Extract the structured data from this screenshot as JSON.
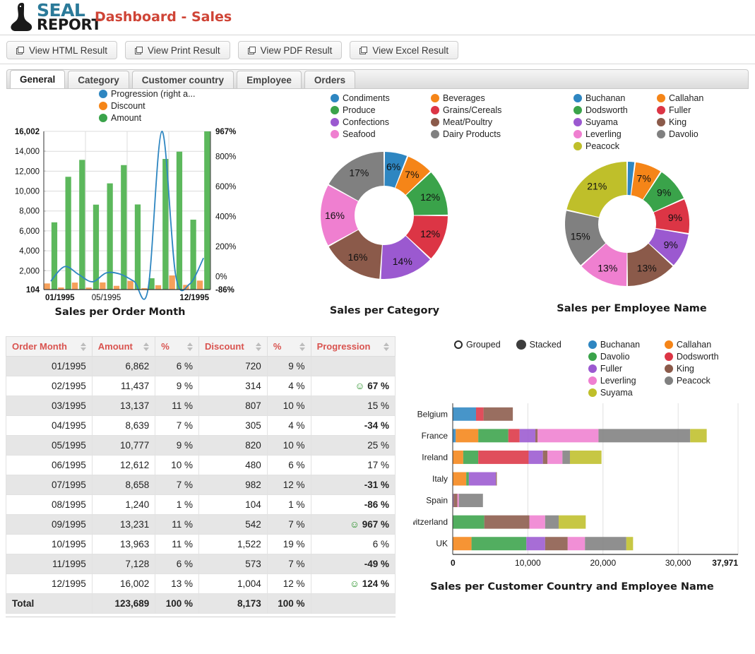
{
  "app": {
    "logo_top": "SEAL",
    "logo_bottom": "REPORT",
    "title": "Dashboard - Sales",
    "logo_color": "#2b7a99",
    "title_color": "#cf4436"
  },
  "toolbar": {
    "buttons": [
      {
        "label": "View HTML Result",
        "icon": "external-window-icon"
      },
      {
        "label": "View Print Result",
        "icon": "external-window-icon"
      },
      {
        "label": "View PDF Result",
        "icon": "external-window-icon"
      },
      {
        "label": "View Excel Result",
        "icon": "external-window-icon"
      }
    ]
  },
  "tabs": [
    {
      "label": "General",
      "active": true
    },
    {
      "label": "Category",
      "active": false
    },
    {
      "label": "Customer country",
      "active": false
    },
    {
      "label": "Employee",
      "active": false
    },
    {
      "label": "Orders",
      "active": false
    }
  ],
  "palette": {
    "blue": "#2e86c1",
    "orange": "#f58518",
    "green": "#3aa34a",
    "red": "#dc3545",
    "purple": "#9b59d0",
    "brown": "#8b5a4a",
    "pink": "#ef7fd0",
    "gray": "#808080",
    "olive": "#bfbf2a"
  },
  "chart_data": [
    {
      "id": "sales-per-order-month",
      "type": "bar",
      "title": "Sales per Order Month",
      "categories": [
        "01/1995",
        "02/1995",
        "03/1995",
        "04/1995",
        "05/1995",
        "06/1995",
        "07/1995",
        "08/1995",
        "09/1995",
        "10/1995",
        "11/1995",
        "12/1995"
      ],
      "xlabel": "",
      "ylabel": "",
      "x_tick_labels": [
        "01/1995",
        "05/1995",
        "12/1995"
      ],
      "left_axis": {
        "ticks": [
          "104",
          "2,000",
          "4,000",
          "6,000",
          "8,000",
          "10,000",
          "12,000",
          "14,000",
          "16,002"
        ],
        "min": 104,
        "max": 16002
      },
      "right_axis": {
        "ticks": [
          "-86%",
          "0%",
          "200%",
          "400%",
          "600%",
          "800%",
          "967%"
        ],
        "min": -86,
        "max": 967
      },
      "legend": [
        {
          "label": "Progression (right a...",
          "color": "#2e86c1"
        },
        {
          "label": "Discount",
          "color": "#f58518"
        },
        {
          "label": "Amount",
          "color": "#3aa34a"
        }
      ],
      "series": [
        {
          "name": "Amount",
          "kind": "bar",
          "color": "#3aa34a",
          "values": [
            6862,
            11437,
            13137,
            8639,
            10777,
            12612,
            8658,
            1240,
            13231,
            13963,
            7128,
            16002
          ]
        },
        {
          "name": "Discount",
          "kind": "bar",
          "color": "#f58518",
          "values": [
            720,
            314,
            807,
            305,
            820,
            480,
            982,
            104,
            542,
            1522,
            573,
            1004
          ]
        },
        {
          "name": "Progression (right a...)",
          "kind": "line",
          "color": "#2e86c1",
          "values": [
            null,
            67,
            15,
            -34,
            25,
            17,
            -31,
            -86,
            967,
            6,
            -49,
            124
          ]
        }
      ]
    },
    {
      "id": "sales-per-category",
      "type": "pie",
      "title": "Sales per Category",
      "hole": 0.38,
      "legend": [
        {
          "label": "Condiments",
          "color": "#2e86c1"
        },
        {
          "label": "Beverages",
          "color": "#f58518"
        },
        {
          "label": "Produce",
          "color": "#3aa34a"
        },
        {
          "label": "Grains/Cereals",
          "color": "#dc3545"
        },
        {
          "label": "Confections",
          "color": "#9b59d0"
        },
        {
          "label": "Meat/Poultry",
          "color": "#8b5a4a"
        },
        {
          "label": "Seafood",
          "color": "#ef7fd0"
        },
        {
          "label": "Dairy Products",
          "color": "#808080"
        }
      ],
      "slices": [
        {
          "label": "Condiments",
          "value": 6,
          "display": "6%",
          "color": "#2e86c1"
        },
        {
          "label": "Beverages",
          "value": 7,
          "display": "7%",
          "color": "#f58518"
        },
        {
          "label": "Produce",
          "value": 12,
          "display": "12%",
          "color": "#3aa34a"
        },
        {
          "label": "Grains/Cereals",
          "value": 12,
          "display": "12%",
          "color": "#dc3545"
        },
        {
          "label": "Confections",
          "value": 14,
          "display": "14%",
          "color": "#9b59d0"
        },
        {
          "label": "Meat/Poultry",
          "value": 16,
          "display": "16%",
          "color": "#8b5a4a"
        },
        {
          "label": "Seafood",
          "value": 16,
          "display": "16%",
          "color": "#ef7fd0"
        },
        {
          "label": "Dairy Products",
          "value": 17,
          "display": "17%",
          "color": "#808080"
        }
      ]
    },
    {
      "id": "sales-per-employee-name",
      "type": "pie",
      "title": "Sales per Employee Name",
      "hole": 0.38,
      "legend": [
        {
          "label": "Buchanan",
          "color": "#2e86c1"
        },
        {
          "label": "Callahan",
          "color": "#f58518"
        },
        {
          "label": "Dodsworth",
          "color": "#3aa34a"
        },
        {
          "label": "Fuller",
          "color": "#dc3545"
        },
        {
          "label": "Suyama",
          "color": "#9b59d0"
        },
        {
          "label": "King",
          "color": "#8b5a4a"
        },
        {
          "label": "Leverling",
          "color": "#ef7fd0"
        },
        {
          "label": "Davolio",
          "color": "#808080"
        },
        {
          "label": "Peacock",
          "color": "#bfbf2a"
        }
      ],
      "slices": [
        {
          "label": "Buchanan",
          "value": 2,
          "display": "",
          "color": "#2e86c1"
        },
        {
          "label": "Callahan",
          "value": 7,
          "display": "7%",
          "color": "#f58518"
        },
        {
          "label": "Dodsworth",
          "value": 9,
          "display": "9%",
          "color": "#3aa34a"
        },
        {
          "label": "Fuller",
          "value": 9,
          "display": "9%",
          "color": "#dc3545"
        },
        {
          "label": "Suyama",
          "value": 9,
          "display": "9%",
          "color": "#9b59d0"
        },
        {
          "label": "King",
          "value": 13,
          "display": "13%",
          "color": "#8b5a4a"
        },
        {
          "label": "Leverling",
          "value": 13,
          "display": "13%",
          "color": "#ef7fd0"
        },
        {
          "label": "Davolio",
          "value": 15,
          "display": "15%",
          "color": "#808080"
        },
        {
          "label": "Peacock",
          "value": 21,
          "display": "21%",
          "color": "#bfbf2a"
        }
      ]
    },
    {
      "id": "sales-per-customer-country-and-employee-name",
      "type": "bar",
      "orientation": "horizontal",
      "stacked": true,
      "title": "Sales per Customer Country and Employee Name",
      "controls": [
        {
          "label": "Grouped",
          "selected": false
        },
        {
          "label": "Stacked",
          "selected": true
        }
      ],
      "legend": [
        {
          "label": "Buchanan",
          "color": "#2e86c1"
        },
        {
          "label": "Callahan",
          "color": "#f58518"
        },
        {
          "label": "Davolio",
          "color": "#3aa34a"
        },
        {
          "label": "Dodsworth",
          "color": "#dc3545"
        },
        {
          "label": "Fuller",
          "color": "#9b59d0"
        },
        {
          "label": "King",
          "color": "#8b5a4a"
        },
        {
          "label": "Leverling",
          "color": "#ef7fd0"
        },
        {
          "label": "Peacock",
          "color": "#808080"
        },
        {
          "label": "Suyama",
          "color": "#bfbf2a"
        }
      ],
      "categories": [
        "Belgium",
        "France",
        "Ireland",
        "Italy",
        "Spain",
        "Switzerland",
        "UK"
      ],
      "x_tick_labels": [
        "0",
        "10,000",
        "20,000",
        "30,000",
        "37,971"
      ],
      "xlim": [
        0,
        37971
      ],
      "series": [
        {
          "name": "Buchanan",
          "color": "#2e86c1",
          "values": [
            3100,
            400,
            0,
            0,
            0,
            0,
            0
          ]
        },
        {
          "name": "Callahan",
          "color": "#f58518",
          "values": [
            0,
            3000,
            1400,
            1800,
            0,
            0,
            2500
          ]
        },
        {
          "name": "Davolio",
          "color": "#3aa34a",
          "values": [
            0,
            4000,
            2000,
            350,
            0,
            4200,
            7300
          ]
        },
        {
          "name": "Dodsworth",
          "color": "#dc3545",
          "values": [
            1000,
            1500,
            6700,
            0,
            0,
            0,
            0
          ]
        },
        {
          "name": "Fuller",
          "color": "#9b59d0",
          "values": [
            0,
            2100,
            1900,
            3600,
            120,
            0,
            2500
          ]
        },
        {
          "name": "King",
          "color": "#8b5a4a",
          "values": [
            3900,
            300,
            600,
            120,
            500,
            6000,
            3000
          ]
        },
        {
          "name": "Leverling",
          "color": "#ef7fd0",
          "values": [
            0,
            8100,
            2000,
            0,
            200,
            2100,
            2300
          ]
        },
        {
          "name": "Peacock",
          "color": "#808080",
          "values": [
            0,
            12200,
            1000,
            0,
            3200,
            1800,
            5500
          ]
        },
        {
          "name": "Suyama",
          "color": "#bfbf2a",
          "values": [
            0,
            2200,
            4200,
            0,
            0,
            3600,
            900
          ]
        }
      ],
      "totals": [
        8000,
        37971,
        19800,
        5870,
        4020,
        17700,
        24000
      ]
    },
    {
      "id": "sales-table",
      "type": "table",
      "columns": [
        "Order Month",
        "Amount",
        "%",
        "Discount",
        "%",
        "Progression"
      ],
      "rows": [
        {
          "month": "01/1995",
          "amount": "6,862",
          "amount_pct": "6 %",
          "discount": "720",
          "discount_pct": "9 %",
          "progression": "",
          "progression_state": "none"
        },
        {
          "month": "02/1995",
          "amount": "11,437",
          "amount_pct": "9 %",
          "discount": "314",
          "discount_pct": "4 %",
          "progression": "67 %",
          "progression_state": "good"
        },
        {
          "month": "03/1995",
          "amount": "13,137",
          "amount_pct": "11 %",
          "discount": "807",
          "discount_pct": "10 %",
          "progression": "15 %",
          "progression_state": "plain"
        },
        {
          "month": "04/1995",
          "amount": "8,639",
          "amount_pct": "7 %",
          "discount": "305",
          "discount_pct": "4 %",
          "progression": "-34 %",
          "progression_state": "bad"
        },
        {
          "month": "05/1995",
          "amount": "10,777",
          "amount_pct": "9 %",
          "discount": "820",
          "discount_pct": "10 %",
          "progression": "25 %",
          "progression_state": "plain"
        },
        {
          "month": "06/1995",
          "amount": "12,612",
          "amount_pct": "10 %",
          "discount": "480",
          "discount_pct": "6 %",
          "progression": "17 %",
          "progression_state": "plain"
        },
        {
          "month": "07/1995",
          "amount": "8,658",
          "amount_pct": "7 %",
          "discount": "982",
          "discount_pct": "12 %",
          "progression": "-31 %",
          "progression_state": "bad"
        },
        {
          "month": "08/1995",
          "amount": "1,240",
          "amount_pct": "1 %",
          "discount": "104",
          "discount_pct": "1 %",
          "progression": "-86 %",
          "progression_state": "bad"
        },
        {
          "month": "09/1995",
          "amount": "13,231",
          "amount_pct": "11 %",
          "discount": "542",
          "discount_pct": "7 %",
          "progression": "967 %",
          "progression_state": "good"
        },
        {
          "month": "10/1995",
          "amount": "13,963",
          "amount_pct": "11 %",
          "discount": "1,522",
          "discount_pct": "19 %",
          "progression": "6 %",
          "progression_state": "plain"
        },
        {
          "month": "11/1995",
          "amount": "7,128",
          "amount_pct": "6 %",
          "discount": "573",
          "discount_pct": "7 %",
          "progression": "-49 %",
          "progression_state": "bad"
        },
        {
          "month": "12/1995",
          "amount": "16,002",
          "amount_pct": "13 %",
          "discount": "1,004",
          "discount_pct": "12 %",
          "progression": "124 %",
          "progression_state": "good"
        }
      ],
      "total_row": {
        "label": "Total",
        "amount": "123,689",
        "amount_pct": "100 %",
        "discount": "8,173",
        "discount_pct": "100 %",
        "progression": ""
      }
    }
  ]
}
